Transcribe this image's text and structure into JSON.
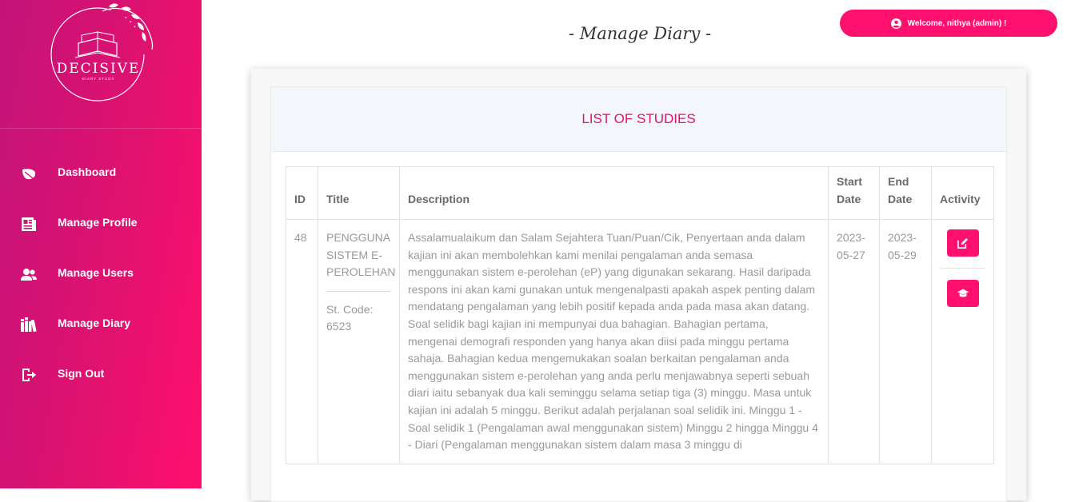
{
  "sidebar": {
    "logo": {
      "name": "DECISIVE",
      "tagline": "DIARY STUDY"
    },
    "items": [
      {
        "label": "Dashboard",
        "icon": "leaf-icon"
      },
      {
        "label": "Manage Profile",
        "icon": "profile-document-icon"
      },
      {
        "label": "Manage Users",
        "icon": "users-icon"
      },
      {
        "label": "Manage Diary",
        "icon": "books-icon"
      },
      {
        "label": "Sign Out",
        "icon": "sign-out-icon"
      }
    ]
  },
  "header": {
    "welcome": "Welcome, nithya (admin) !",
    "page_title": "- Manage Diary -"
  },
  "card": {
    "title": "LIST OF STUDIES"
  },
  "table": {
    "columns": {
      "id": "ID",
      "title": "Title",
      "description": "Description",
      "start": "Start Date",
      "end": "End Date",
      "activity": "Activity"
    },
    "rows": [
      {
        "id": "48",
        "title": "PENGGUNA SISTEM E-PEROLEHAN",
        "code": "St. Code: 6523",
        "description": "Assalamualaikum dan Salam Sejahtera Tuan/Puan/Cik, Penyertaan anda dalam kajian ini akan membolehkan kami menilai pengalaman anda semasa menggunakan sistem e-perolehan (eP) yang digunakan sekarang. Hasil daripada respons ini akan kami gunakan untuk mengenalpasti apakah aspek penting dalam mendatang pengalaman yang lebih positif kepada anda pada masa akan datang. Soal selidik bagi kajian ini mempunyai dua bahagian. Bahagian pertama, mengenai demografi responden yang hanya akan diisi pada minggu pertama sahaja. Bahagian kedua mengemukakan soalan berkaitan pengalaman anda menggunakan sistem e-perolehan yang anda perlu menjawabnya seperti sebuah diari iaitu sebanyak dua kali seminggu selama setiap tiga (3) minggu. Masa untuk kajian ini adalah 5 minggu. Berikut adalah perjalanan soal selidik ini. Minggu 1 - Soal selidik 1 (Pengalaman awal menggunakan sistem) Minggu 2 hingga Minggu 4 - Diari (Pengalaman menggunakan sistem dalam masa 3 minggu di",
        "start": "2023-05-27",
        "end": "2023-05-29",
        "actions": [
          {
            "icon": "edit-icon"
          },
          {
            "icon": "graduation-cap-icon"
          }
        ]
      }
    ]
  },
  "colors": {
    "accent": "#ff0f6e",
    "sidebar_start": "#c2137a",
    "header_bg": "#f3f6fa"
  }
}
